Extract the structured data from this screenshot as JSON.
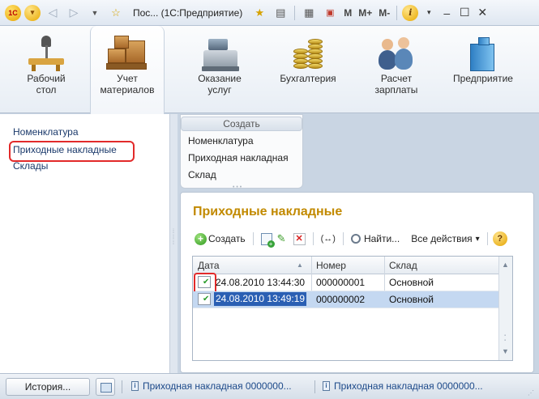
{
  "titlebar": {
    "app_title": "Пос... (1С:Предприятие)",
    "memory_buttons": [
      "M",
      "M+",
      "M-"
    ]
  },
  "sections": [
    {
      "label": "Рабочий\nстол",
      "icon": "desk-lamp-icon"
    },
    {
      "label": "Учет\nматериалов",
      "icon": "boxes-icon",
      "active": true
    },
    {
      "label": "Оказание\nуслуг",
      "icon": "cash-register-icon"
    },
    {
      "label": "Бухгалтерия",
      "icon": "coins-icon"
    },
    {
      "label": "Расчет\nзарплаты",
      "icon": "people-icon"
    },
    {
      "label": "Предприятие",
      "icon": "building-icon"
    }
  ],
  "leftnav": {
    "items": [
      "Номенклатура",
      "Приходные накладные",
      "Склады"
    ],
    "highlighted_index": 1
  },
  "create_panel": {
    "title": "Создать",
    "items": [
      "Номенклатура",
      "Приходная накладная",
      "Склад"
    ]
  },
  "form": {
    "title": "Приходные накладные",
    "toolbar": {
      "create_label": "Создать",
      "find_label": "Найти...",
      "all_actions_label": "Все действия",
      "all_actions_arrow": "▾",
      "refresh_label": "(↔)",
      "help_label": "?"
    },
    "table": {
      "columns": [
        "Дата",
        "Номер",
        "Склад"
      ],
      "rows": [
        {
          "date": "24.08.2010 13:44:30",
          "number": "000000001",
          "warehouse": "Основной",
          "selected": false
        },
        {
          "date": "24.08.2010 13:49:19",
          "number": "000000002",
          "warehouse": "Основной",
          "selected": true
        }
      ]
    }
  },
  "statusbar": {
    "history_label": "История...",
    "open_windows": [
      "Приходная накладная 0000000...",
      "Приходная накладная 0000000..."
    ]
  },
  "colors": {
    "form_title": "#c28a00",
    "highlight_frame": "#e22a2a",
    "selected_row": "#c4d8f1"
  }
}
